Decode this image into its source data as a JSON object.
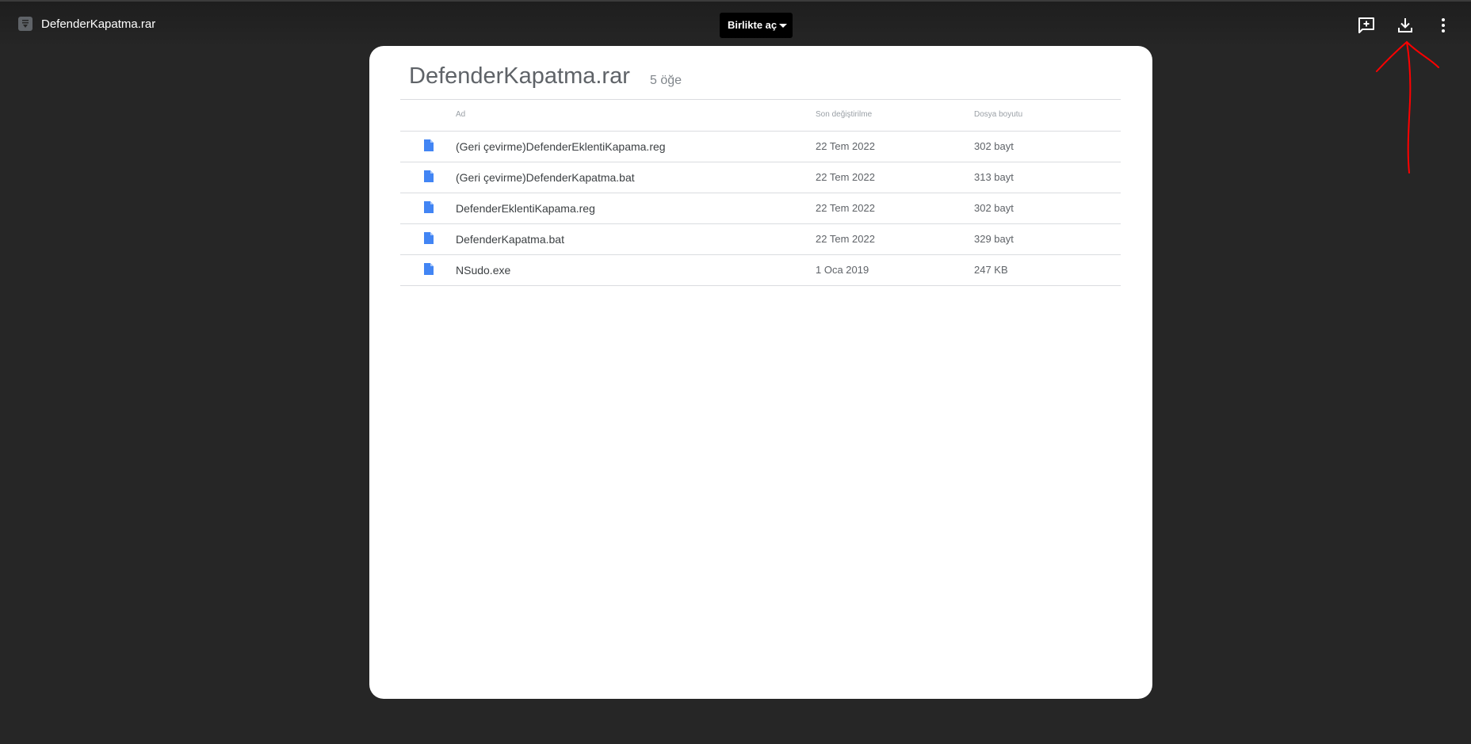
{
  "header": {
    "app_title": "DefenderKapatma.rar",
    "open_with_label": "Birlikte aç",
    "icons": [
      "file-type-icon",
      "add-comment-icon",
      "download-icon",
      "more-vert-icon"
    ]
  },
  "archive": {
    "title": "DefenderKapatma.rar",
    "item_count": "5 öğe",
    "columns": {
      "name": "Ad",
      "modified": "Son değiştirilme",
      "size": "Dosya boyutu"
    },
    "files": [
      {
        "name": "(Geri çevirme)DefenderEklentiKapama.reg",
        "modified": "22 Tem 2022",
        "size": "302 bayt"
      },
      {
        "name": "(Geri çevirme)DefenderKapatma.bat",
        "modified": "22 Tem 2022",
        "size": "313 bayt"
      },
      {
        "name": "DefenderEklentiKapama.reg",
        "modified": "22 Tem 2022",
        "size": "302 bayt"
      },
      {
        "name": "DefenderKapatma.bat",
        "modified": "22 Tem 2022",
        "size": "329 bayt"
      },
      {
        "name": "NSudo.exe",
        "modified": "1 Oca 2019",
        "size": "247 KB"
      }
    ]
  },
  "colors": {
    "background": "#262626",
    "file_icon": "#4285f4",
    "annotation": "#ff0000"
  }
}
